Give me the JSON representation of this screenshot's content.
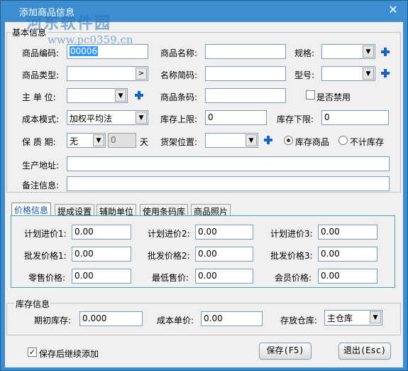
{
  "window": {
    "title": "添加商品信息",
    "close_glyph": "✕"
  },
  "watermark": {
    "title": "河东软件园",
    "url": "www.pc0359.cn"
  },
  "basic": {
    "legend": "基本信息",
    "code_label": "商品编码:",
    "code_value": "00006",
    "name_label": "商品名称:",
    "name_value": "",
    "spec_label": "规格:",
    "spec_value": "",
    "type_label": "商品类型:",
    "type_value": "",
    "abbr_label": "名称简码:",
    "abbr_value": "",
    "model_label": "型号:",
    "model_value": "",
    "unit_label": "主 单 位:",
    "unit_value": "",
    "barcode_label": "商品条码:",
    "barcode_value": "",
    "disabled_label": "是否禁用",
    "cost_mode_label": "成本模式:",
    "cost_mode_value": "加权平均法",
    "stock_max_label": "库存上限:",
    "stock_max_value": "0",
    "stock_min_label": "库存下限:",
    "stock_min_value": "0",
    "shelf_life_label": "保 质 期:",
    "shelf_life_value": "无",
    "shelf_days_value": "0",
    "shelf_days_unit": "天",
    "location_label": "货架位置:",
    "location_value": "",
    "radio_stock": "库存商品",
    "radio_nonstock": "不计库存",
    "address_label": "生产地址:",
    "address_value": "",
    "remark_label": "备注信息:",
    "remark_value": ""
  },
  "tabs": [
    "价格信息",
    "提成设置",
    "辅助单位",
    "使用条码库",
    "商品照片"
  ],
  "prices": {
    "plan1_label": "计划进价1:",
    "plan1": "0.00",
    "plan2_label": "计划进价2:",
    "plan2": "0.00",
    "plan3_label": "计划进价3:",
    "plan3": "0.00",
    "whole1_label": "批发价格1:",
    "whole1": "0.00",
    "whole2_label": "批发价格2:",
    "whole2": "0.00",
    "whole3_label": "批发价格3:",
    "whole3": "0.00",
    "retail_label": "零售价格:",
    "retail": "0.00",
    "min_label": "最低售价:",
    "min": "0.00",
    "member_label": "会员价格:",
    "member": "0.00"
  },
  "stock": {
    "legend": "库存信息",
    "init_label": "期初库存:",
    "init_value": "0.000",
    "cost_label": "成本单价:",
    "cost_value": "0.00",
    "warehouse_label": "存放仓库:",
    "warehouse_value": "主仓库"
  },
  "footer": {
    "continue_label": "保存后继续添加",
    "save_label": "保存(F5)",
    "exit_label": "退出(Esc)"
  },
  "colors": {
    "title_bar": "#3c8ed0",
    "accent": "#1565c0",
    "selection": "#3399ff"
  }
}
